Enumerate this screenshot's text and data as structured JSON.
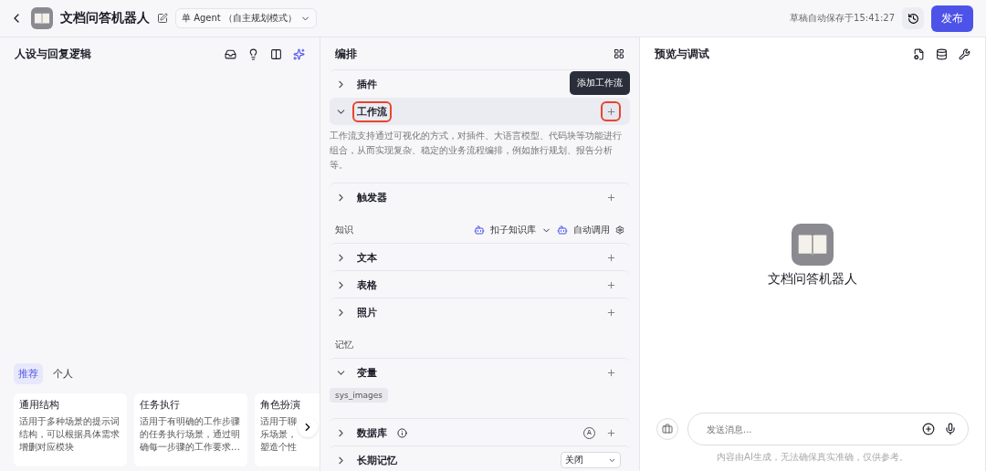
{
  "header": {
    "bot_name": "文档问答机器人",
    "mode": "单 Agent （自主规划模式）",
    "save_status": "草稿自动保存于15:41:27",
    "publish": "发布"
  },
  "persona": {
    "title": "人设与回复逻辑",
    "tabs": [
      {
        "label": "推荐",
        "selected": true
      },
      {
        "label": "个人",
        "selected": false
      }
    ],
    "cards": [
      {
        "title": "通用结构",
        "lines": [
          "适用于多种场景的提示词",
          "结构，可以根据具体需求",
          "增删对应模块"
        ]
      },
      {
        "title": "任务执行",
        "lines": [
          "适用于有明确的工作步骤",
          "的任务执行场景，通过明",
          "确每一步骤的工作要求…"
        ]
      },
      {
        "title": "角色扮演",
        "lines": [
          "适用于聊",
          "乐场景，",
          "塑造个性"
        ]
      }
    ]
  },
  "arrange": {
    "title": "编排",
    "tooltip": "添加工作流",
    "items": [
      {
        "kind": "row",
        "label": "插件",
        "expanded": false,
        "active": false,
        "highlighted": false,
        "addable": false
      },
      {
        "kind": "row",
        "label": "工作流",
        "expanded": true,
        "active": true,
        "highlighted": true,
        "addable": true,
        "description": "工作流支持通过可视化的方式，对插件、大语言模型、代码块等功能进行组合，从而实现复杂、稳定的业务流程编排，例如旅行规划、报告分析等。"
      },
      {
        "kind": "row",
        "label": "触发器",
        "expanded": false,
        "active": false,
        "highlighted": false,
        "addable": true
      },
      {
        "kind": "group",
        "label": "知识",
        "source": "扣子知识库",
        "call_mode": "自动调用"
      },
      {
        "kind": "row",
        "label": "文本",
        "expanded": false,
        "active": false,
        "highlighted": false,
        "addable": true
      },
      {
        "kind": "row",
        "label": "表格",
        "expanded": false,
        "active": false,
        "highlighted": false,
        "addable": true
      },
      {
        "kind": "row",
        "label": "照片",
        "expanded": false,
        "active": false,
        "highlighted": false,
        "addable": true
      },
      {
        "kind": "group",
        "label": "记忆"
      },
      {
        "kind": "row",
        "label": "变量",
        "expanded": true,
        "active": false,
        "highlighted": false,
        "addable": true,
        "tags": [
          "sys_images"
        ]
      },
      {
        "kind": "row",
        "label": "数据库",
        "expanded": false,
        "active": false,
        "highlighted": false,
        "addable": true,
        "info": true,
        "badge": "A"
      },
      {
        "kind": "row",
        "label": "长期记忆",
        "expanded": false,
        "active": false,
        "highlighted": false,
        "addable": false,
        "select": "关闭"
      }
    ]
  },
  "preview": {
    "title": "预览与调试",
    "bot_name": "文档问答机器人",
    "input": {
      "placeholder": "发送消息..."
    },
    "disclaimer": "内容由AI生成，无法确保真实准确，仅供参考。"
  }
}
